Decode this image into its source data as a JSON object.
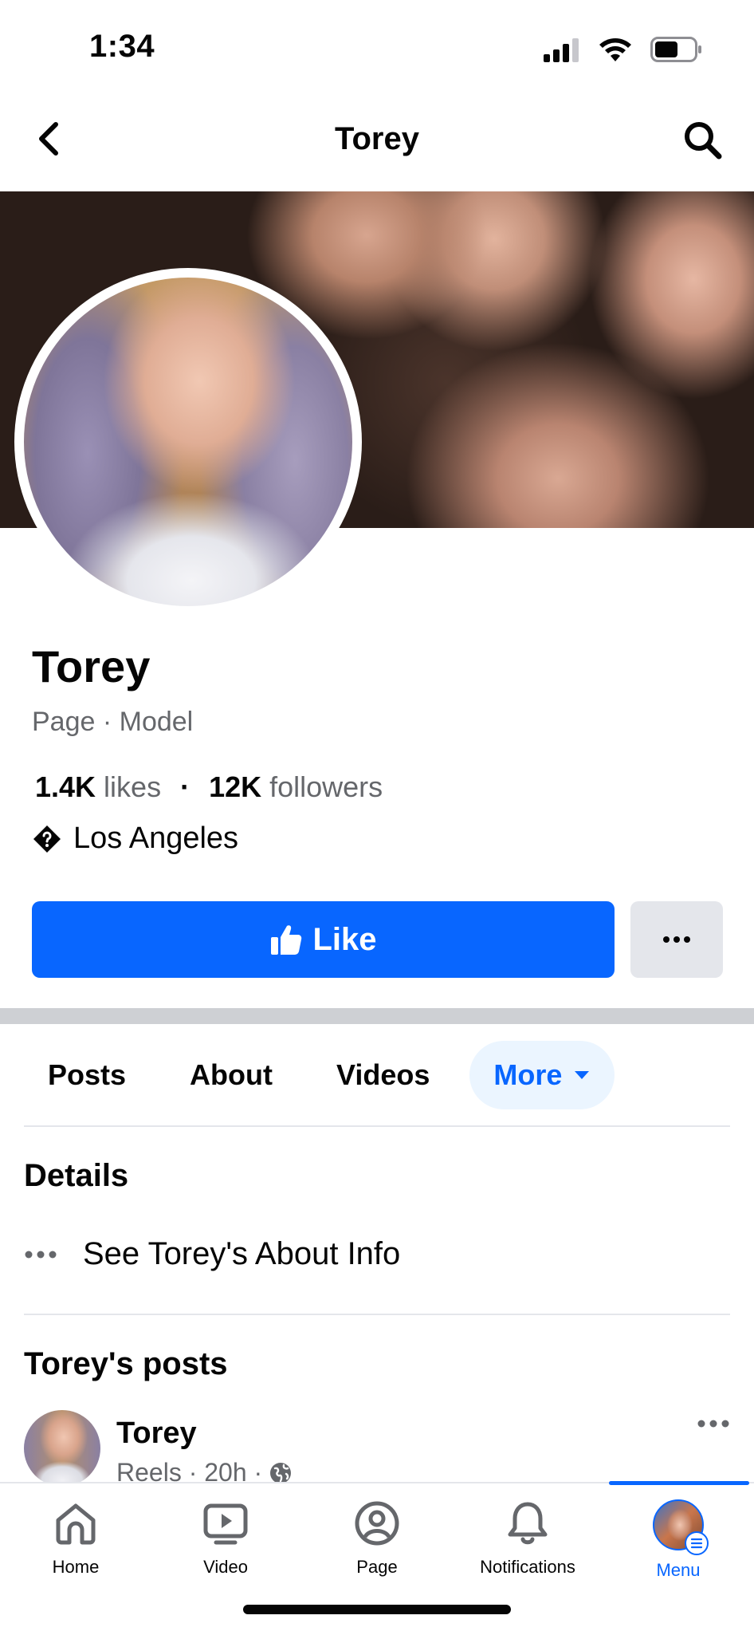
{
  "status_bar": {
    "time": "1:34"
  },
  "header": {
    "title": "Torey"
  },
  "profile": {
    "name": "Torey",
    "category": "Page · Model",
    "likes_count": "1.4K",
    "likes_label": "likes",
    "separator": "·",
    "followers_count": "12K",
    "followers_label": "followers",
    "location": "Los Angeles"
  },
  "actions": {
    "like_label": "Like"
  },
  "tabs": [
    "Posts",
    "About",
    "Videos",
    "More"
  ],
  "details": {
    "title": "Details",
    "row_label": "See Torey's About Info"
  },
  "posts": {
    "title": "Torey's posts",
    "first_post": {
      "author": "Torey",
      "meta": "Reels · 20h ·"
    }
  },
  "bottom_nav": {
    "items": [
      {
        "label": "Home",
        "icon": "home-icon"
      },
      {
        "label": "Video",
        "icon": "video-icon"
      },
      {
        "label": "Page",
        "icon": "page-icon"
      },
      {
        "label": "Notifications",
        "icon": "bell-icon"
      },
      {
        "label": "Menu",
        "icon": "menu-avatar",
        "active": true
      }
    ]
  },
  "colors": {
    "accent": "#0866ff",
    "text": "#050505",
    "muted": "#65676b",
    "secondary_button": "#e4e6eb",
    "divider": "#ced0d4"
  }
}
